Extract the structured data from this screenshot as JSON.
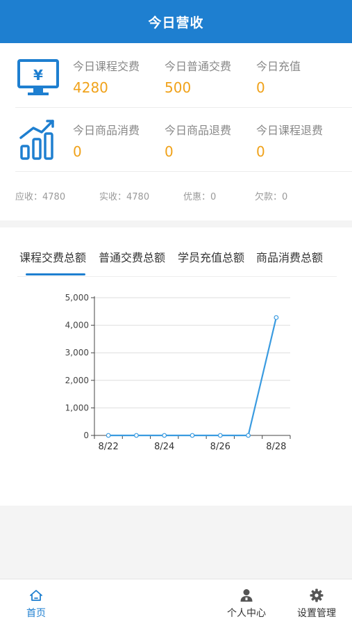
{
  "header": {
    "title": "今日营收"
  },
  "stats": {
    "course_fee": {
      "label": "今日课程交费",
      "value": "4280"
    },
    "normal_fee": {
      "label": "今日普通交费",
      "value": "500"
    },
    "recharge": {
      "label": "今日充值",
      "value": "0"
    },
    "goods_consume": {
      "label": "今日商品消费",
      "value": "0"
    },
    "goods_refund": {
      "label": "今日商品退费",
      "value": "0"
    },
    "course_refund": {
      "label": "今日课程退费",
      "value": "0"
    }
  },
  "totals": {
    "receivable": "应收：4780",
    "received": "实收：4780",
    "discount": "优惠：0",
    "arrears": "欠款：0"
  },
  "tabs": [
    {
      "label": "课程交费总额",
      "active": true
    },
    {
      "label": "普通交费总额",
      "active": false
    },
    {
      "label": "学员充值总额",
      "active": false
    },
    {
      "label": "商品消费总额",
      "active": false
    }
  ],
  "colors": {
    "primary": "#1e7fd0",
    "value_orange": "#f0a21a",
    "line": "#3a9be0"
  },
  "chart_data": {
    "type": "line",
    "x": [
      "8/22",
      "8/23",
      "8/24",
      "8/25",
      "8/26",
      "8/27",
      "8/28"
    ],
    "xtick_labels": [
      "8/22",
      "8/24",
      "8/26",
      "8/28"
    ],
    "series": [
      {
        "values": [
          0,
          0,
          0,
          0,
          0,
          0,
          4280
        ]
      }
    ],
    "ylim": [
      0,
      5000
    ],
    "yticks": [
      "0",
      "1,000",
      "2,000",
      "3,000",
      "4,000",
      "5,000"
    ],
    "grid": true
  },
  "nav": {
    "home": {
      "label": "首页",
      "icon": "home-icon"
    },
    "profile": {
      "label": "个人中心",
      "icon": "user-icon"
    },
    "settings": {
      "label": "设置管理",
      "icon": "gear-icon"
    }
  }
}
